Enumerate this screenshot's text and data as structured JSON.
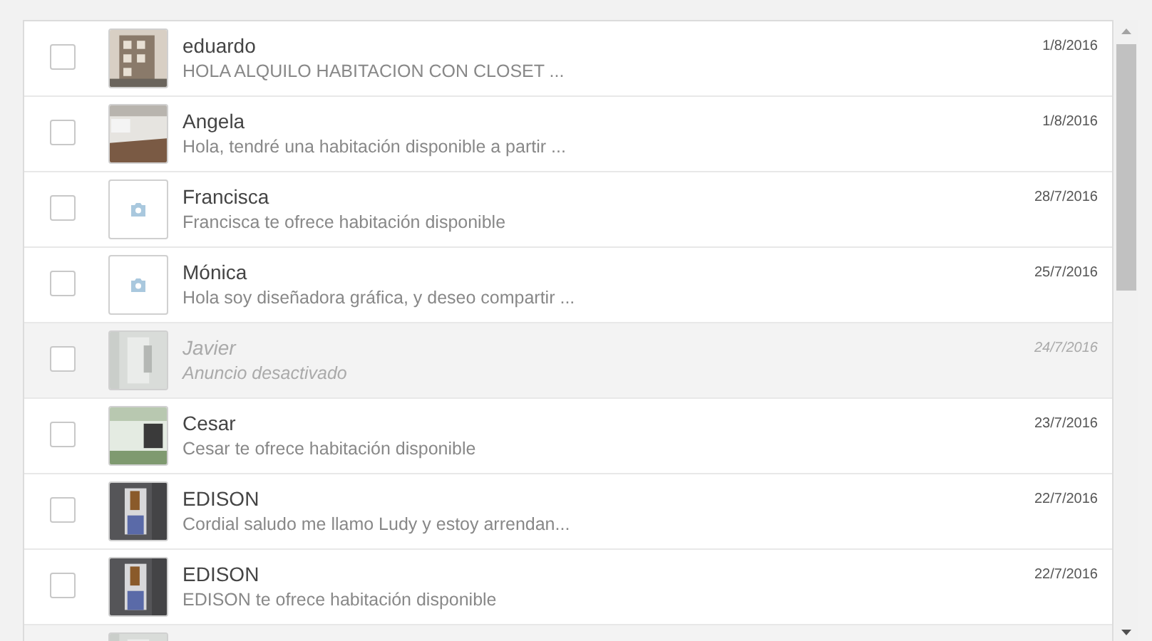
{
  "messages": [
    {
      "kind": "picture",
      "checked": false,
      "disabled": false,
      "name": "eduardo",
      "preview": "HOLA ALQUILO HABITACION CON CLOSET ...",
      "date": "1/8/2016"
    },
    {
      "kind": "picture",
      "checked": false,
      "disabled": false,
      "name": "Angela",
      "preview": "Hola, tendré una habitación disponible a partir ...",
      "date": "1/8/2016"
    },
    {
      "kind": "placeholder",
      "checked": false,
      "disabled": false,
      "name": "Francisca",
      "preview": "Francisca te ofrece habitación disponible",
      "date": "28/7/2016"
    },
    {
      "kind": "placeholder",
      "checked": false,
      "disabled": false,
      "name": "Mónica",
      "preview": "Hola soy diseñadora gráfica, y deseo compartir ...",
      "date": "25/7/2016"
    },
    {
      "kind": "picture",
      "checked": false,
      "disabled": true,
      "name": "Javier",
      "preview": "Anuncio desactivado",
      "date": "24/7/2016"
    },
    {
      "kind": "picture",
      "checked": false,
      "disabled": false,
      "name": "Cesar",
      "preview": "Cesar te ofrece habitación disponible",
      "date": "23/7/2016"
    },
    {
      "kind": "picture",
      "checked": false,
      "disabled": false,
      "name": "EDISON",
      "preview": "Cordial saludo me llamo Ludy y estoy arrendan...",
      "date": "22/7/2016"
    },
    {
      "kind": "picture",
      "checked": false,
      "disabled": false,
      "name": "EDISON",
      "preview": "EDISON te ofrece habitación disponible",
      "date": "22/7/2016"
    },
    {
      "kind": "picture",
      "disabled": true
    }
  ]
}
